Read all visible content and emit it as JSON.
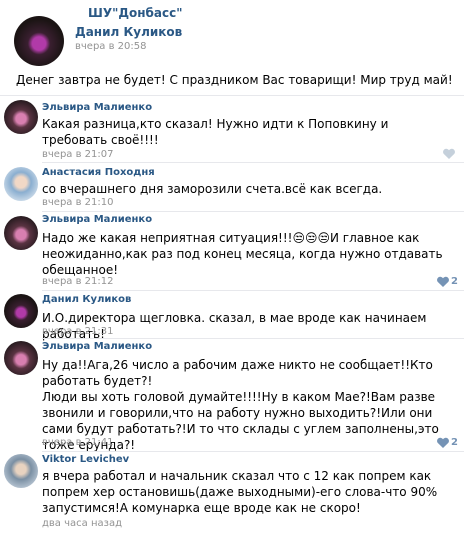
{
  "post": {
    "group": "ШУ\"Донбасс\"",
    "author": "Данил Куликов",
    "time": "вчера в 20:58",
    "text": "Денег завтра не будет! С праздником Вас товарищи! Мир труд май!"
  },
  "comments": [
    {
      "author": "Эльвира Малиенко",
      "text": "Какая разница,кто сказал! Нужно идти к Поповкину и требовать своё!!!!",
      "time": "вчера в 21:07",
      "likes": ""
    },
    {
      "author": "Анастасия Походня",
      "text": "со вчерашнего дня заморозили счета.всё как всегда.",
      "time": "вчера в 21:10",
      "likes": ""
    },
    {
      "author": "Эльвира Малиенко",
      "text": "Надо же какая неприятная ситуация!!!😒😒😒И главное как неожиданно,как раз под конец месяца, когда нужно отдавать обещанное!",
      "time": "вчера в 21:12",
      "likes": "2"
    },
    {
      "author": "Данил Куликов",
      "text": "И.О.директора щегловка.   сказал, в мае вроде как начинаем работать!",
      "time": "вчера в 21:31",
      "likes": ""
    },
    {
      "author": "Эльвира Малиенко",
      "text": "Ну да!!Ага,26 число а рабочим даже никто не сообщает!!Кто работать будет?!\nЛюди вы хоть головой думайте!!!!Ну в каком Мае?!Вам разве звонили и говорили,что на работу нужно выходить?!Или они сами будут работать?!И то что склады с углем заполнены,это тоже ерунда?!",
      "time": "вчера в 21:41",
      "likes": "2"
    },
    {
      "author": "Viktor Levichev",
      "text": "я вчера работал и начальник сказал что с 12 как попрем как попрем хер остановишь(даже выходными)-его слова-что 90% запустимся!А комунарка еще вроде как не скоро!",
      "time": "два часа назад",
      "likes": ""
    }
  ],
  "icons": {
    "like": "heart-icon"
  },
  "colors": {
    "link": "#2a5885",
    "muted": "#939393",
    "like": "#7593b5"
  }
}
